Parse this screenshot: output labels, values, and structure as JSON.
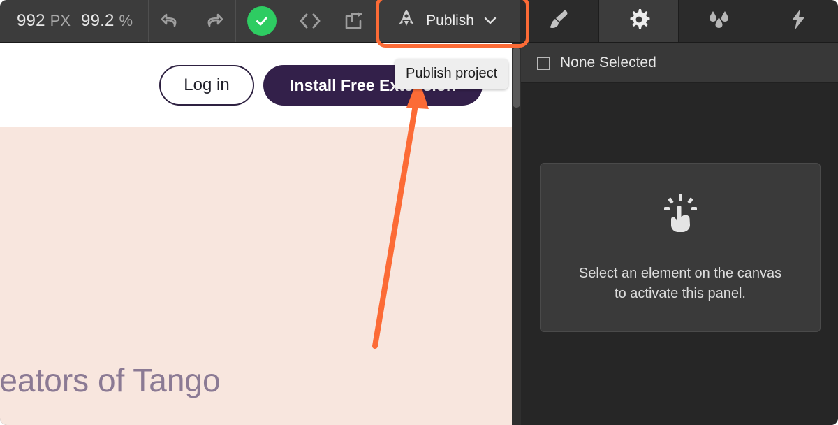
{
  "toolbar": {
    "zoom_width_value": "992",
    "zoom_width_unit": "PX",
    "zoom_scale_value": "99.2",
    "zoom_scale_unit": "%",
    "undo_icon": "undo-arrow-icon",
    "redo_icon": "redo-arrow-icon",
    "confirm_icon": "check-circle-icon",
    "code_icon": "code-brackets-icon",
    "share_icon": "share-export-icon",
    "publish_label": "Publish",
    "publish_icon": "rocket-icon",
    "publish_chevron_icon": "chevron-down-icon",
    "right_tabs": [
      {
        "name": "style-tab",
        "icon": "paintbrush-icon",
        "active": false
      },
      {
        "name": "settings-tab",
        "icon": "gear-icon",
        "active": true
      },
      {
        "name": "effects-tab",
        "icon": "water-drops-icon",
        "active": false
      },
      {
        "name": "interactions-tab",
        "icon": "lightning-bolt-icon",
        "active": false
      }
    ]
  },
  "canvas": {
    "login_label": "Log in",
    "install_label": "Install Free Extension",
    "hero_text": "reators of Tango",
    "background_color": "#f8e6de",
    "header_background": "#ffffff",
    "install_button_color": "#33204a",
    "hero_text_color": "#8b7a94"
  },
  "panel": {
    "header_label": "None Selected",
    "header_icon": "square-outline-icon",
    "empty_icon": "click-hand-icon",
    "empty_line1": "Select an element on the canvas",
    "empty_line2": "to activate this panel."
  },
  "annotations": {
    "highlight_color": "#fc6b36",
    "tooltip_text": "Publish project",
    "arrow_icon": "pointer-arrow-icon"
  }
}
